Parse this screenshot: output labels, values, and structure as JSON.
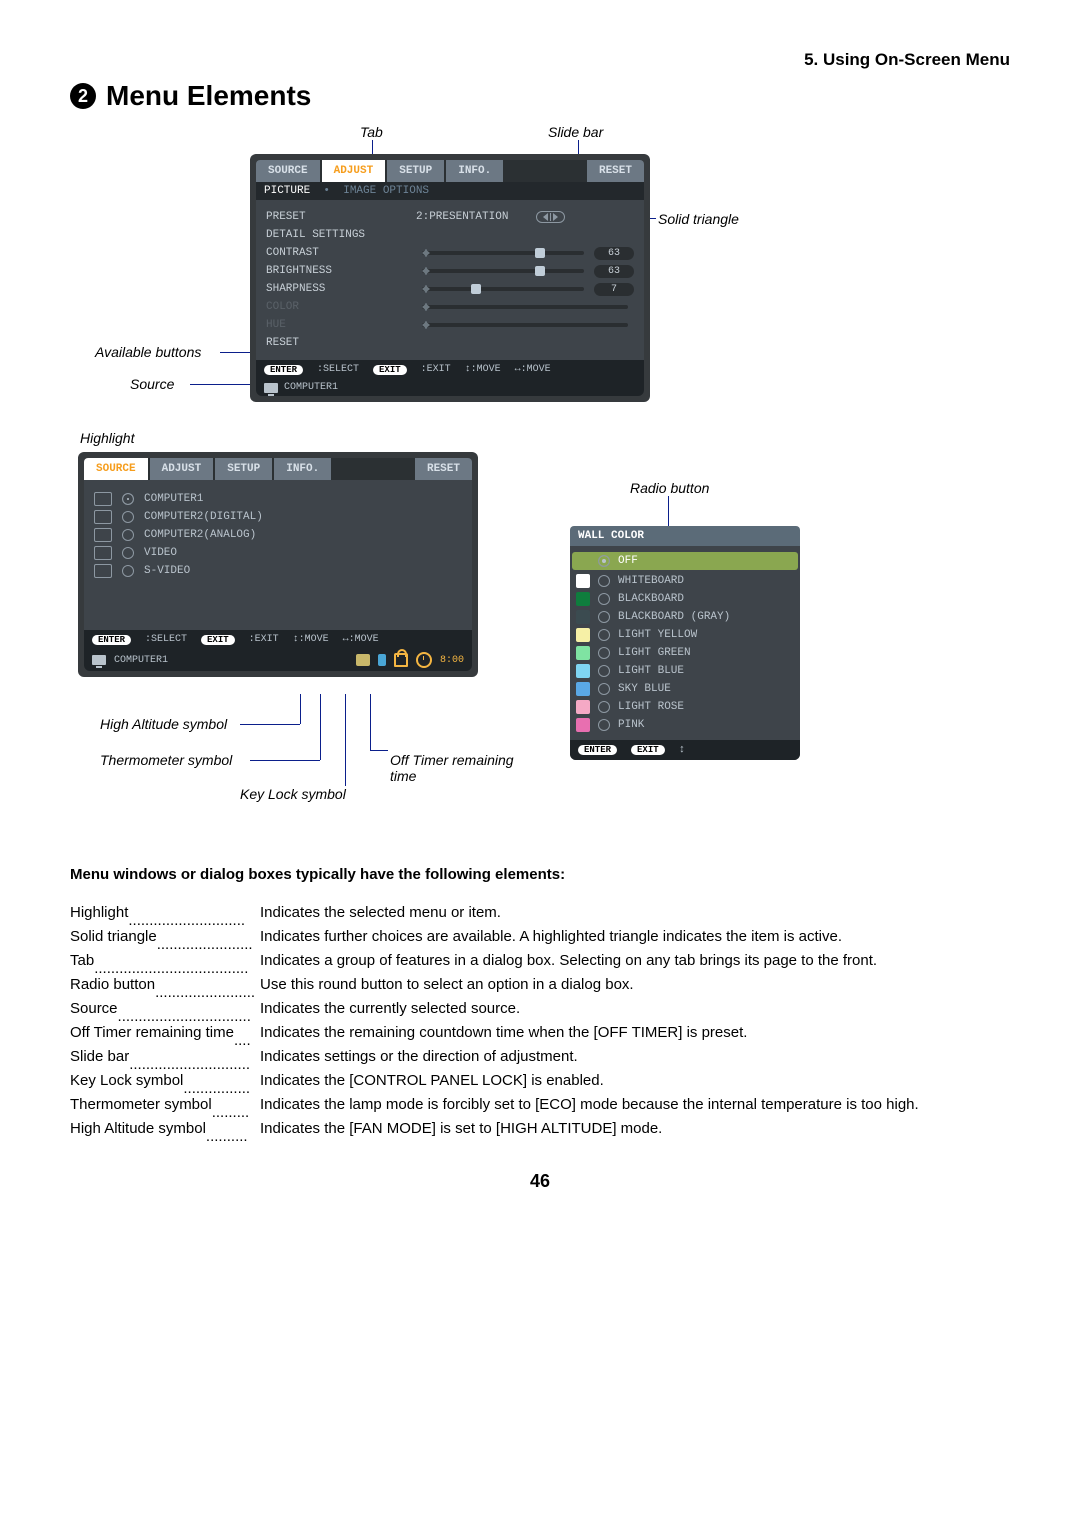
{
  "header": {
    "section": "5. Using On-Screen Menu"
  },
  "title": {
    "num": "2",
    "text": "Menu Elements"
  },
  "labels": {
    "tab": "Tab",
    "slide_bar": "Slide bar",
    "solid_triangle": "Solid triangle",
    "available_buttons": "Available buttons",
    "source": "Source",
    "highlight": "Highlight",
    "radio_button": "Radio button",
    "high_alt": "High Altitude symbol",
    "thermo": "Thermometer symbol",
    "key_lock": "Key Lock symbol",
    "off_timer": "Off Timer remaining time"
  },
  "osd1": {
    "tabs": [
      "SOURCE",
      "ADJUST",
      "SETUP",
      "INFO.",
      "RESET"
    ],
    "active_tab": 1,
    "subtabs_html": "PICTURE  •  IMAGE OPTIONS",
    "rows": [
      {
        "lab": "PRESET",
        "val": "2:PRESENTATION",
        "type": "preset"
      },
      {
        "lab": "DETAIL SETTINGS",
        "type": "plain"
      },
      {
        "lab": "CONTRAST",
        "type": "slider",
        "badge": "63",
        "thumb": 70
      },
      {
        "lab": "BRIGHTNESS",
        "type": "slider",
        "badge": "63",
        "thumb": 70
      },
      {
        "lab": "SHARPNESS",
        "type": "slider",
        "badge": "7",
        "thumb": 30
      },
      {
        "lab": "COLOR",
        "type": "slider",
        "disabled": true
      },
      {
        "lab": "HUE",
        "type": "slider",
        "disabled": true
      },
      {
        "lab": "RESET",
        "type": "plain"
      }
    ],
    "footer": {
      "enter": "ENTER",
      "select": ":SELECT",
      "exit": "EXIT",
      "exitl": ":EXIT",
      "move1": "↕:MOVE",
      "move2": "↔:MOVE"
    },
    "source": "COMPUTER1"
  },
  "osd2": {
    "tabs": [
      "SOURCE",
      "ADJUST",
      "SETUP",
      "INFO.",
      "RESET"
    ],
    "active_tab": 0,
    "items": [
      "COMPUTER1",
      "COMPUTER2(DIGITAL)",
      "COMPUTER2(ANALOG)",
      "VIDEO",
      "S-VIDEO"
    ],
    "selected": 0,
    "footer": {
      "enter": "ENTER",
      "select": ":SELECT",
      "exit": "EXIT",
      "exitl": ":EXIT",
      "move1": "↕:MOVE",
      "move2": "↔:MOVE"
    },
    "source": "COMPUTER1",
    "timer": "8:00"
  },
  "wall": {
    "title": "WALL COLOR",
    "items": [
      {
        "name": "OFF",
        "color": "#8aa750",
        "off": true
      },
      {
        "name": "WHITEBOARD",
        "color": "#ffffff"
      },
      {
        "name": "BLACKBOARD",
        "color": "#0f7d3d"
      },
      {
        "name": "BLACKBOARD (GRAY)",
        "color": "#3b4b50"
      },
      {
        "name": "LIGHT YELLOW",
        "color": "#f6f0a6"
      },
      {
        "name": "LIGHT GREEN",
        "color": "#7fe3a2"
      },
      {
        "name": "LIGHT BLUE",
        "color": "#7fd5f2"
      },
      {
        "name": "SKY BLUE",
        "color": "#5aa9e6"
      },
      {
        "name": "LIGHT ROSE",
        "color": "#f5a9c5"
      },
      {
        "name": "PINK",
        "color": "#e86fb0"
      }
    ],
    "footer": {
      "enter": "ENTER",
      "exit": "EXIT",
      "updown": "↕"
    }
  },
  "desc_head": "Menu windows or dialog boxes typically have the following elements:",
  "defs": [
    {
      "term": "Highlight",
      "dots": "............................",
      "desc": "Indicates the selected menu or item."
    },
    {
      "term": "Solid triangle",
      "dots": ".......................",
      "desc": "Indicates further choices are available. A highlighted triangle indicates the item is active."
    },
    {
      "term": "Tab",
      "dots": ".....................................",
      "desc": "Indicates a group of features in a dialog box. Selecting on any tab brings its page to the front."
    },
    {
      "term": "Radio button",
      "dots": "........................",
      "desc": "Use this round button to select an option in a dialog box."
    },
    {
      "term": "Source",
      "dots": "................................",
      "desc": "Indicates the currently selected source."
    },
    {
      "term": "Off Timer remaining time",
      "dots": "....",
      "desc": "Indicates the remaining countdown time when the [OFF TIMER] is preset."
    },
    {
      "term": "Slide bar",
      "dots": ".............................",
      "desc": "Indicates settings or the direction of adjustment."
    },
    {
      "term": "Key Lock symbol",
      "dots": "................",
      "desc": "Indicates the [CONTROL PANEL LOCK] is enabled."
    },
    {
      "term": "Thermometer symbol",
      "dots": ".........",
      "desc": "Indicates the lamp mode is forcibly set to [ECO] mode because the internal temperature is too high.",
      "two": true
    },
    {
      "term": "High Altitude symbol",
      "dots": "..........",
      "desc": "Indicates the [FAN MODE] is set to [HIGH ALTITUDE] mode."
    }
  ],
  "page_number": "46"
}
